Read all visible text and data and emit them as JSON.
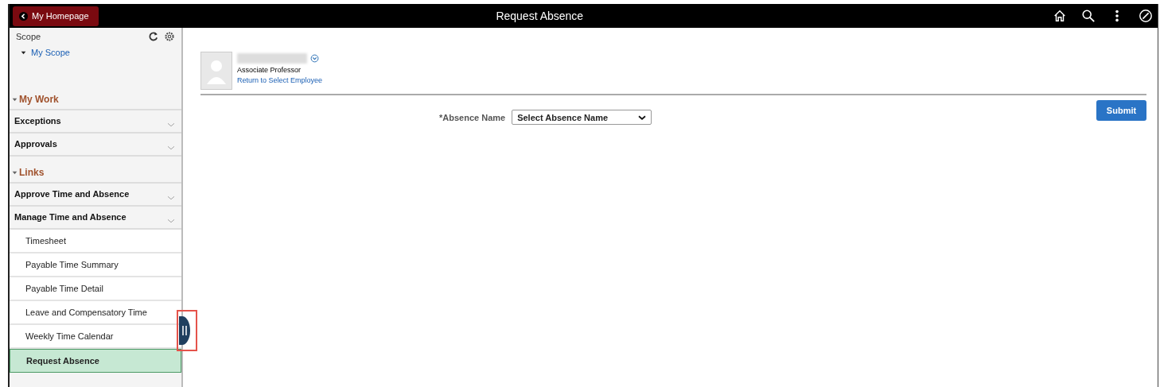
{
  "header": {
    "back_button": "My Homepage",
    "title": "Request Absence"
  },
  "sidebar": {
    "scope_label": "Scope",
    "scope_link": {
      "label": "My Scope",
      "expanded": true
    },
    "sections": [
      {
        "title": "My Work",
        "expanded": true,
        "items": [
          {
            "label": "Exceptions"
          },
          {
            "label": "Approvals"
          }
        ]
      },
      {
        "title": "Links",
        "expanded": true,
        "items": [
          {
            "label": "Approve Time and Absence"
          },
          {
            "label": "Manage Time and Absence",
            "children": [
              {
                "label": "Timesheet",
                "selected": false
              },
              {
                "label": "Payable Time Summary",
                "selected": false
              },
              {
                "label": "Payable Time Detail",
                "selected": false
              },
              {
                "label": "Leave and Compensatory Time",
                "selected": false
              },
              {
                "label": "Weekly Time Calendar",
                "selected": false
              },
              {
                "label": "Request Absence",
                "selected": true
              }
            ]
          }
        ]
      }
    ]
  },
  "employee": {
    "title": "Associate Professor",
    "link": "Return to Select Employee"
  },
  "submit_button": "Submit",
  "absence_field": {
    "label": "*Absence Name",
    "value": "Select Absence Name"
  }
}
